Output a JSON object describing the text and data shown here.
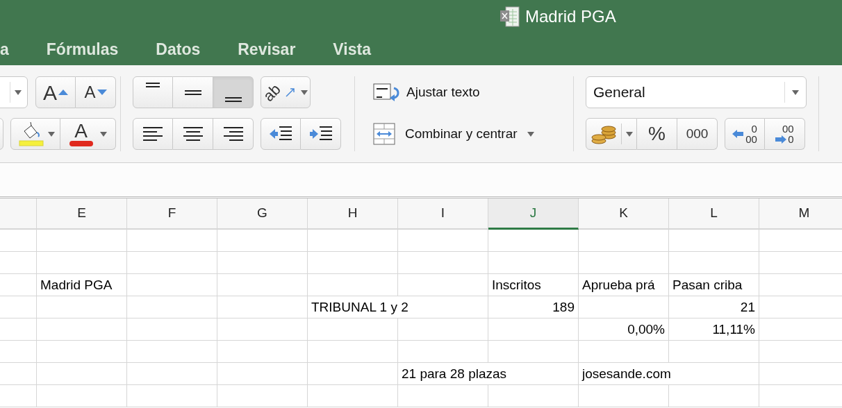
{
  "window": {
    "title": "Madrid PGA"
  },
  "tabs": [
    {
      "label": "a",
      "selected": false
    },
    {
      "label": "Fórmulas",
      "selected": false
    },
    {
      "label": "Datos",
      "selected": false
    },
    {
      "label": "Revisar",
      "selected": false
    },
    {
      "label": "Vista",
      "selected": false
    }
  ],
  "ribbon": {
    "font_grow": "A",
    "font_shrink": "A",
    "font_color": "A",
    "orientation": "ab",
    "vertical_align": [
      {
        "selected": false
      },
      {
        "selected": false
      },
      {
        "selected": true
      }
    ],
    "horizontal_align": [
      {
        "selected": false
      },
      {
        "selected": false
      },
      {
        "selected": false
      }
    ],
    "wrap_text": "Ajustar texto",
    "merge_center": "Combinar y centrar",
    "number_format": "General",
    "percent": "%",
    "thousands": "000",
    "increase_decimal": [
      "0",
      "00"
    ],
    "decrease_decimal": [
      "00",
      "0"
    ]
  },
  "sheet": {
    "columns": [
      {
        "label": "E",
        "selected": false
      },
      {
        "label": "F",
        "selected": false
      },
      {
        "label": "G",
        "selected": false
      },
      {
        "label": "H",
        "selected": false
      },
      {
        "label": "I",
        "selected": false
      },
      {
        "label": "J",
        "selected": true
      },
      {
        "label": "K",
        "selected": false
      },
      {
        "label": "L",
        "selected": false
      },
      {
        "label": "M",
        "selected": false
      }
    ],
    "rows": [
      [],
      [],
      [
        {
          "text": "Madrid PGA",
          "kind": "text"
        },
        {
          "text": "",
          "kind": "text"
        },
        {
          "text": "",
          "kind": "text"
        },
        {
          "text": "",
          "kind": "text"
        },
        {
          "text": "",
          "kind": "text"
        },
        {
          "text": "Inscritos",
          "kind": "text"
        },
        {
          "text": "Aprueba prá",
          "kind": "text"
        },
        {
          "text": "Pasan criba",
          "kind": "text"
        }
      ],
      [
        {
          "text": "",
          "kind": "text"
        },
        {
          "text": "",
          "kind": "text"
        },
        {
          "text": "",
          "kind": "text"
        },
        {
          "text": "TRIBUNAL 1 y 2",
          "kind": "wide"
        },
        {
          "kind": "covered"
        },
        {
          "text": "189",
          "kind": "number"
        },
        {
          "text": "",
          "kind": "text"
        },
        {
          "text": "21",
          "kind": "number"
        }
      ],
      [
        {
          "text": "",
          "kind": "text"
        },
        {
          "text": "",
          "kind": "text"
        },
        {
          "text": "",
          "kind": "text"
        },
        {
          "text": "",
          "kind": "text"
        },
        {
          "text": "",
          "kind": "text"
        },
        {
          "text": "",
          "kind": "text"
        },
        {
          "text": "0,00%",
          "kind": "number"
        },
        {
          "text": "11,11%",
          "kind": "number"
        }
      ],
      [],
      [
        {
          "text": "",
          "kind": "text"
        },
        {
          "text": "",
          "kind": "text"
        },
        {
          "text": "",
          "kind": "text"
        },
        {
          "text": "",
          "kind": "text"
        },
        {
          "text": "21 para 28 plazas",
          "kind": "wide"
        },
        {
          "kind": "covered"
        },
        {
          "text": "josesande.com",
          "kind": "wide"
        },
        {
          "kind": "covered"
        }
      ],
      []
    ]
  }
}
